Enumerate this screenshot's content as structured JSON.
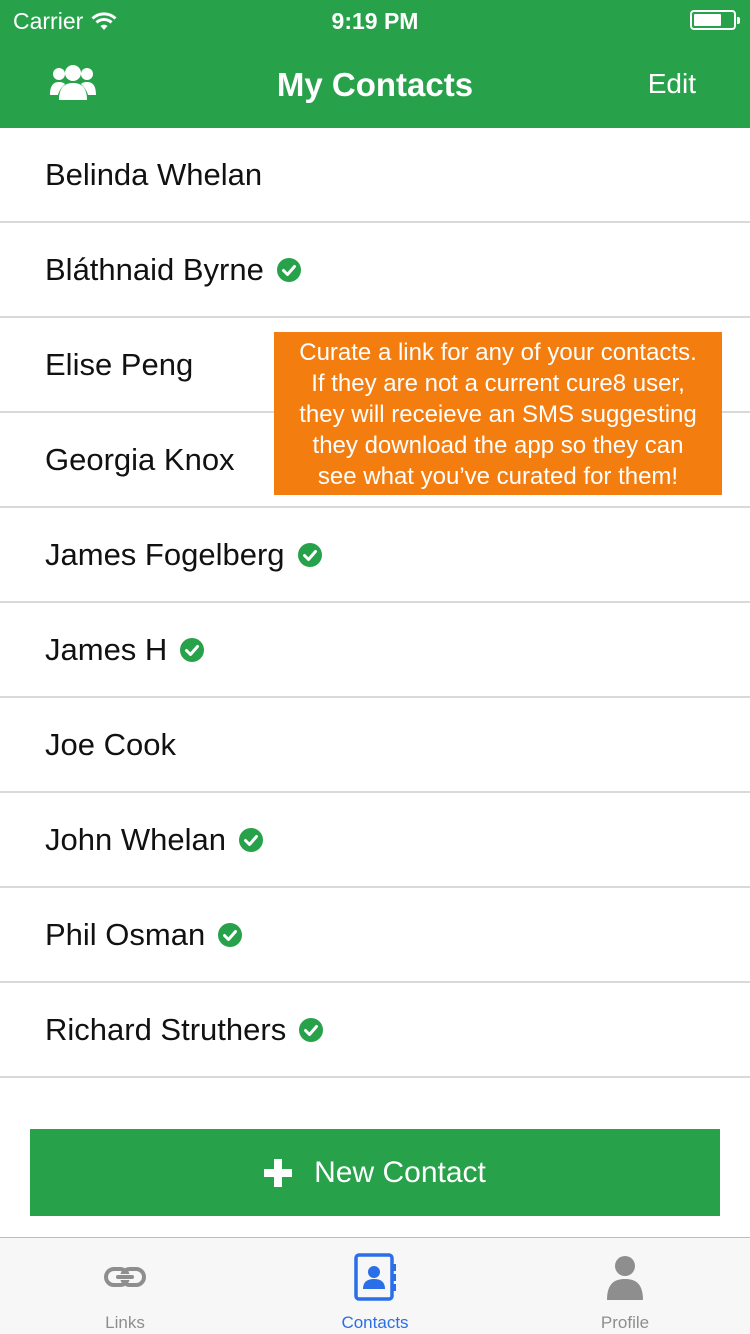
{
  "status_bar": {
    "carrier": "Carrier",
    "time": "9:19 PM",
    "battery_level": 0.7
  },
  "nav": {
    "title": "My Contacts",
    "right_label": "Edit",
    "left_icon": "group-icon"
  },
  "contacts": [
    {
      "name": "Belinda Whelan",
      "verified": false
    },
    {
      "name": "Bláthnaid Byrne",
      "verified": true
    },
    {
      "name": "Elise Peng",
      "verified": false
    },
    {
      "name": "Georgia Knox",
      "verified": false
    },
    {
      "name": "James Fogelberg",
      "verified": true
    },
    {
      "name": "James H",
      "verified": true
    },
    {
      "name": "Joe Cook",
      "verified": false
    },
    {
      "name": "John Whelan",
      "verified": true
    },
    {
      "name": "Phil Osman",
      "verified": true
    },
    {
      "name": "Richard Struthers",
      "verified": true
    }
  ],
  "tooltip": {
    "lines": [
      "Curate a link for any of your contacts.",
      "If they are not a current cure8 user,",
      "they will receieve an SMS suggesting",
      "they download the app so they can",
      "see what you’ve curated for them!"
    ]
  },
  "new_contact_button": {
    "label": "New Contact"
  },
  "tabs": [
    {
      "label": "Links",
      "icon": "link-icon",
      "active": false
    },
    {
      "label": "Contacts",
      "icon": "contacts-book-icon",
      "active": true
    },
    {
      "label": "Profile",
      "icon": "person-icon",
      "active": false
    }
  ],
  "colors": {
    "brand_green": "#27a24a",
    "tooltip_orange": "#f47d10",
    "active_blue": "#2a6ee8",
    "check_green": "#27a24a"
  }
}
